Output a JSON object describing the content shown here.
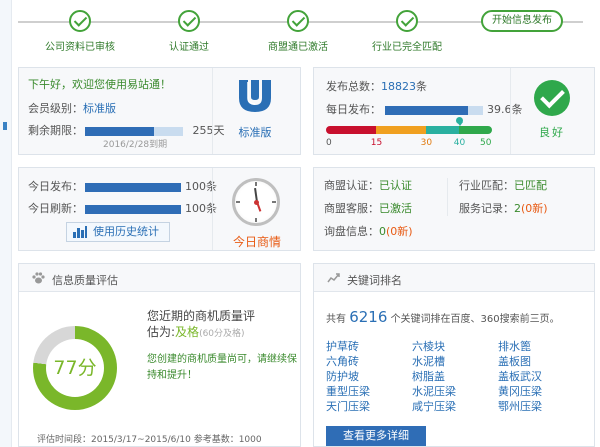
{
  "steps": [
    {
      "label": "公司资料已审核"
    },
    {
      "label": "认证通过"
    },
    {
      "label": "商盟通已激活"
    },
    {
      "label": "行业已完全匹配"
    }
  ],
  "steps_final": "开始信息发布",
  "welcome": {
    "greeting": "下午好，欢迎您使用易站通！",
    "level_label": "会员级别：",
    "level_value": "标准版",
    "remaining_label": "剩余期限：",
    "remaining_value": "255天",
    "remaining_fraction": 0.7,
    "expire_text": "2016/2/28到期",
    "badge_label": "标准版",
    "badge_icon": "shield-u-icon"
  },
  "publish": {
    "total_label": "发布总数：",
    "total_value": "18823",
    "total_unit": "条",
    "daily_label": "每日发布：",
    "daily_value": "39.6条",
    "daily_fraction": 0.85,
    "gauge_value": 40,
    "gauge_ticks": [
      "0",
      "15",
      "30",
      "40",
      "50"
    ],
    "gauge_colors": [
      "#c8102e",
      "#f0a020",
      "#2ab0a0",
      "#2fa84b"
    ],
    "status_label": "良好",
    "status_icon": "check-icon"
  },
  "today": {
    "publish_label": "今日发布：",
    "publish_value": "100条",
    "refresh_label": "今日刷新：",
    "refresh_value": "100条",
    "history_button": "使用历史统计",
    "history_icon": "bar-chart-icon",
    "clock_label": "今日商情",
    "clock_icon": "clock-icon"
  },
  "cert": {
    "shangmeng_label": "商盟认证：",
    "shangmeng_value": "已认证",
    "industry_label": "行业匹配：",
    "industry_value": "已匹配",
    "service_label": "商盟客服：",
    "service_value": "已激活",
    "record_label": "服务记录：",
    "record_value": "2",
    "record_new": "(0新)",
    "inquiry_label": "询盘信息：",
    "inquiry_value": "0",
    "inquiry_new": "(0新)"
  },
  "quality": {
    "title": "信息质量评估",
    "title_icon": "paw-icon",
    "score": "77分",
    "score_fraction": 0.77,
    "desc_line1": "您近期的商机质量评",
    "desc_line2_prefix": "估为:",
    "grade": "及格",
    "grade_note": "(60分及格)",
    "message": "您创建的商机质量尚可，请继续保持和提升！",
    "footer": "评估时间段：2015/3/17~2015/6/10    参考基数：1000"
  },
  "keywords": {
    "title": "关键词排名",
    "title_icon": "trend-icon",
    "summary_prefix": "共有",
    "count": "6216",
    "summary_suffix": "个关键词排在百度、360搜索前三页。",
    "items": [
      "护草砖",
      "六棱块",
      "排水篦",
      "六角砖",
      "水泥槽",
      "盖板图",
      "防护坡",
      "树脂盖",
      "盖板武汉",
      "重型压梁",
      "水泥压梁",
      "黄冈压梁",
      "天门压梁",
      "咸宁压梁",
      "鄂州压梁"
    ],
    "more_button": "查看更多详细"
  }
}
